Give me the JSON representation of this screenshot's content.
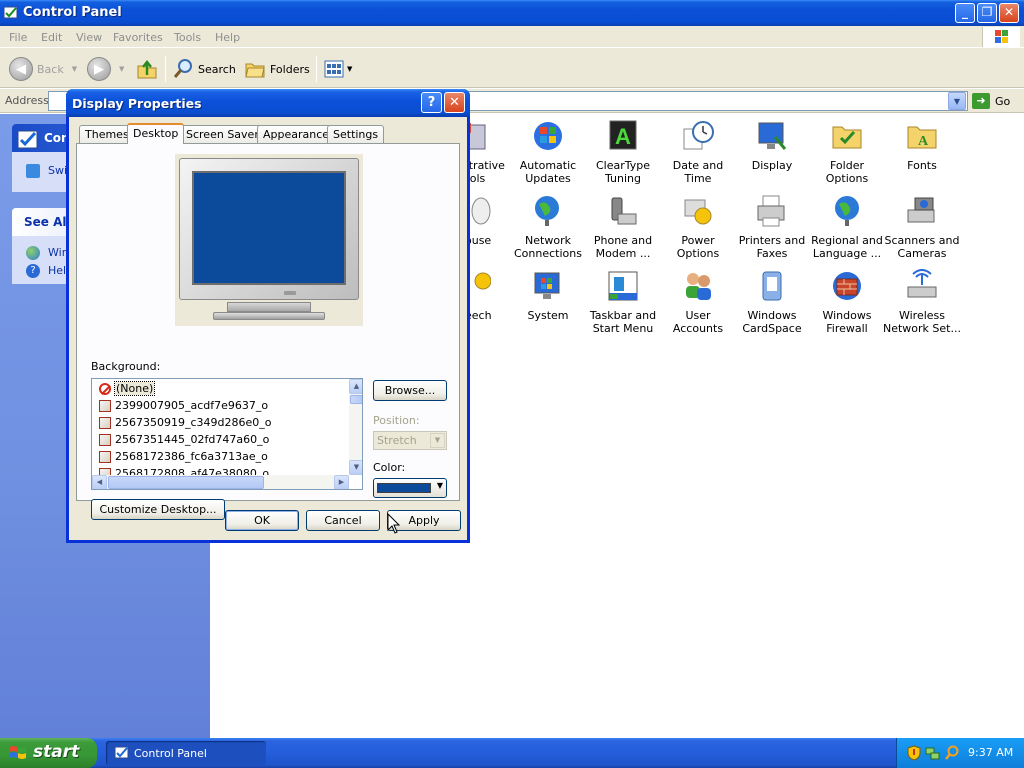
{
  "window": {
    "title": "Control Panel"
  },
  "menubar": [
    "File",
    "Edit",
    "View",
    "Favorites",
    "Tools",
    "Help"
  ],
  "toolbar": {
    "back": "Back",
    "search": "Search",
    "folders": "Folders"
  },
  "addressbar": {
    "label": "Address",
    "go": "Go"
  },
  "tasks": {
    "panel_title": "Con",
    "switch_label": "Swi",
    "see_also_title": "See Als",
    "see_also_items": [
      "Win",
      "Help"
    ]
  },
  "icons": [
    {
      "label": "strative\nools"
    },
    {
      "label": "Automatic\nUpdates"
    },
    {
      "label": "ClearType\nTuning"
    },
    {
      "label": "Date and Time"
    },
    {
      "label": "Display"
    },
    {
      "label": "Folder Options"
    },
    {
      "label": "Fonts"
    },
    {
      "label": "ouse"
    },
    {
      "label": "Network\nConnections"
    },
    {
      "label": "Phone and\nModem ..."
    },
    {
      "label": "Power Options"
    },
    {
      "label": "Printers and\nFaxes"
    },
    {
      "label": "Regional and\nLanguage ..."
    },
    {
      "label": "Scanners and\nCameras"
    },
    {
      "label": "eech"
    },
    {
      "label": "System"
    },
    {
      "label": "Taskbar and\nStart Menu"
    },
    {
      "label": "User Accounts"
    },
    {
      "label": "Windows\nCardSpace"
    },
    {
      "label": "Windows\nFirewall"
    },
    {
      "label": "Wireless\nNetwork Set..."
    }
  ],
  "dialog": {
    "title": "Display Properties",
    "help": "?",
    "close": "✕",
    "tabs": [
      "Themes",
      "Desktop",
      "Screen Saver",
      "Appearance",
      "Settings"
    ],
    "active_tab": "Desktop",
    "background_label": "Background:",
    "background_items": [
      "(None)",
      "2399007905_acdf7e9637_o",
      "2567350919_c349d286e0_o",
      "2567351445_02fd747a60_o",
      "2568172386_fc6a3713ae_o",
      "2568172808_af47e38080_o"
    ],
    "browse": "Browse...",
    "position_label": "Position:",
    "position_value": "Stretch",
    "color_label": "Color:",
    "desktop_color": "#0c4a9c",
    "customize": "Customize Desktop...",
    "ok": "OK",
    "cancel": "Cancel",
    "apply": "Apply"
  },
  "taskbar": {
    "start": "start",
    "task": "Control Panel",
    "clock": "9:37 AM"
  }
}
